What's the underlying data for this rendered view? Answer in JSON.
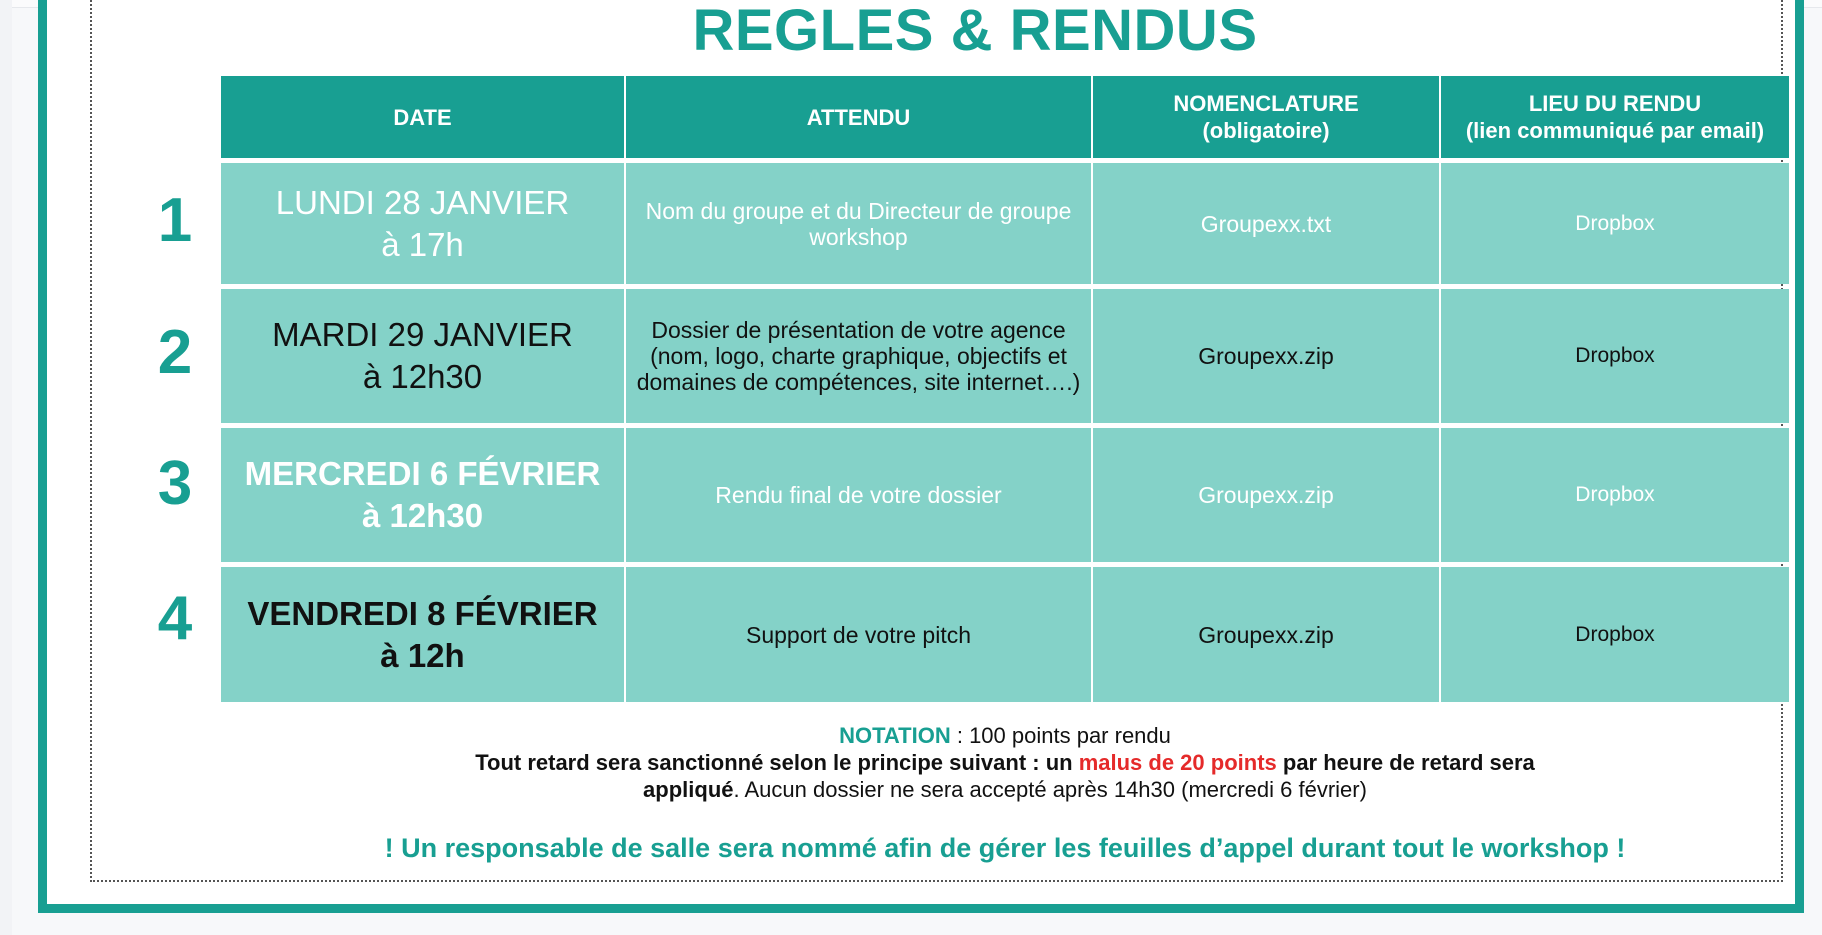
{
  "title": "REGLES & RENDUS",
  "table": {
    "headers": {
      "date": "DATE",
      "attendu": "ATTENDU",
      "nomenclature": "NOMENCLATURE",
      "nomenclature_sub": "(obligatoire)",
      "lieu": "LIEU DU RENDU",
      "lieu_sub": "(lien communiqué par email)"
    },
    "rows": [
      {
        "num": "1",
        "day": "LUNDI 28 JANVIER",
        "time": "à 17h",
        "attendu": "Nom du groupe et du Directeur de groupe workshop",
        "nomenclature": "Groupexx.txt",
        "lieu": "Dropbox"
      },
      {
        "num": "2",
        "day": "MARDI 29 JANVIER",
        "time": "à 12h30",
        "attendu": "Dossier de présentation de votre agence (nom, logo, charte graphique, objectifs et domaines de compétences, site internet….)",
        "nomenclature": "Groupexx.zip",
        "lieu": "Dropbox"
      },
      {
        "num": "3",
        "day": "MERCREDI 6 FÉVRIER",
        "time": "à 12h30",
        "attendu": "Rendu final de votre dossier",
        "nomenclature": "Groupexx.zip",
        "lieu": "Dropbox"
      },
      {
        "num": "4",
        "day": "VENDREDI 8 FÉVRIER",
        "time": "à 12h",
        "attendu": "Support de votre pitch",
        "nomenclature": "Groupexx.zip",
        "lieu": "Dropbox"
      }
    ]
  },
  "notation": {
    "label": "NOTATION",
    "text": " : 100 points par rendu",
    "retard_a": "Tout retard sera sanctionné selon le principe suivant : un ",
    "retard_malus": "malus de 20 points",
    "retard_b": " par heure de retard sera",
    "applique": "appliqué",
    "applique_rest": ". Aucun dossier ne sera accepté après 14h30 (mercredi 6 février)"
  },
  "footer": "! Un responsable de salle sera nommé afin de gérer les feuilles d’appel durant tout le workshop !",
  "colors": {
    "teal": "#189f92",
    "cell": "#84d2c8",
    "red": "#e52a2a"
  }
}
